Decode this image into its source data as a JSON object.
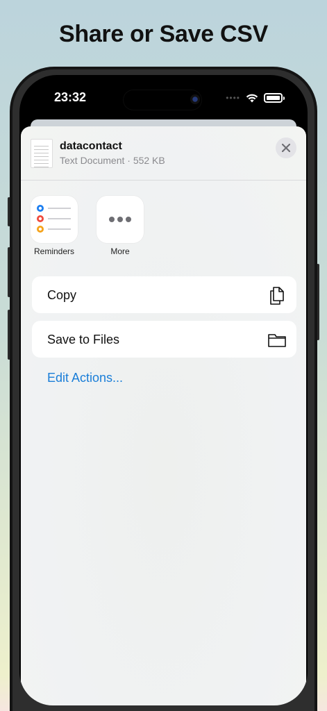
{
  "page": {
    "headline": "Share or Save CSV"
  },
  "status_bar": {
    "time": "23:32"
  },
  "share_sheet": {
    "file": {
      "name": "datacontact",
      "meta": "Text Document · 552 KB"
    },
    "apps": [
      {
        "label": "Reminders",
        "icon": "reminders-icon"
      },
      {
        "label": "More",
        "icon": "more-icon"
      }
    ],
    "actions": [
      {
        "label": "Copy",
        "icon": "copy-icon"
      },
      {
        "label": "Save to Files",
        "icon": "folder-icon"
      }
    ],
    "edit_actions_label": "Edit Actions..."
  },
  "colors": {
    "accent_blue": "#1a7ed8",
    "reminder_blue": "#1c7ef0",
    "reminder_red": "#f04a3c",
    "reminder_orange": "#f5a31a"
  }
}
